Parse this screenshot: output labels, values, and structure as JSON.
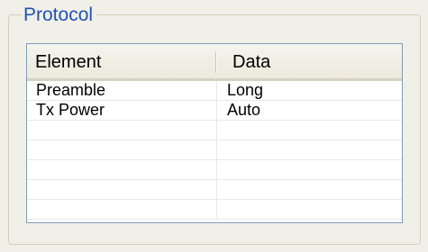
{
  "group": {
    "title": "Protocol"
  },
  "listview": {
    "columns": [
      "Element",
      "Data"
    ],
    "rows": [
      {
        "element": "Preamble",
        "data": "Long"
      },
      {
        "element": "Tx Power",
        "data": "Auto"
      },
      {
        "element": "",
        "data": ""
      },
      {
        "element": "",
        "data": ""
      },
      {
        "element": "",
        "data": ""
      },
      {
        "element": "",
        "data": ""
      },
      {
        "element": "",
        "data": ""
      }
    ]
  },
  "colors": {
    "background": "#f1f0e8",
    "group_title": "#2153b4",
    "list_border": "#7f9db9",
    "grid_line": "#e8e8e8"
  }
}
